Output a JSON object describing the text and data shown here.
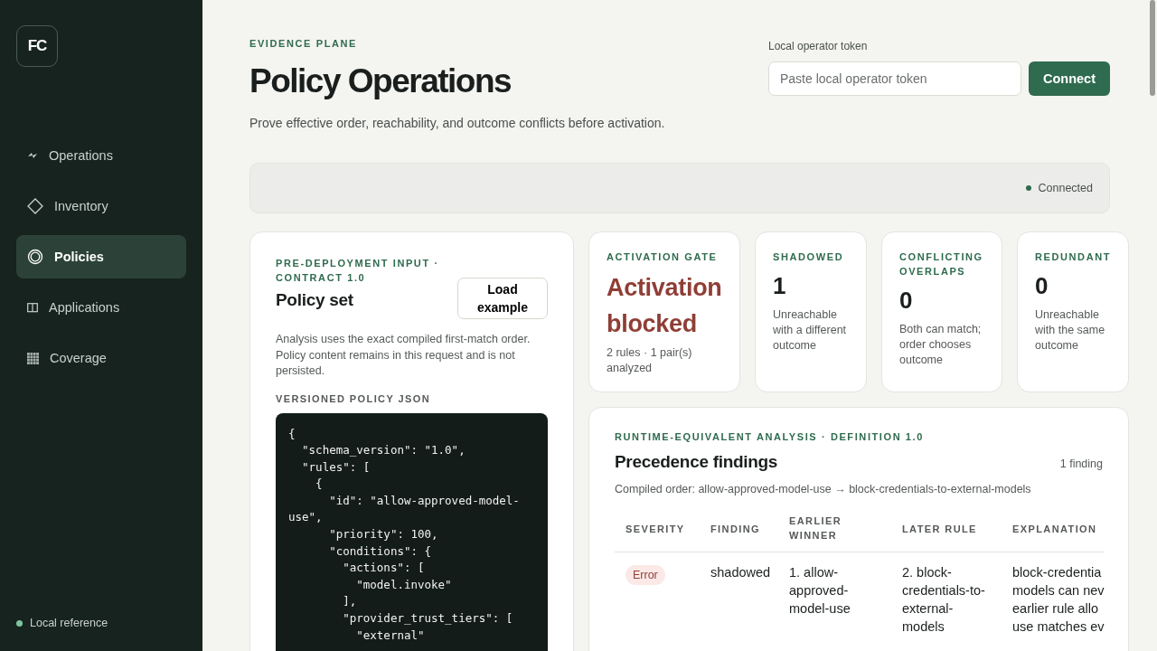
{
  "sidebar": {
    "logo": "FC",
    "items": [
      {
        "label": "Operations",
        "selected": false
      },
      {
        "label": "Inventory",
        "selected": false
      },
      {
        "label": "Policies",
        "selected": true
      },
      {
        "label": "Applications",
        "selected": false
      },
      {
        "label": "Coverage",
        "selected": false
      }
    ],
    "footer": {
      "label": "Local reference",
      "color": "#7fc4a0"
    }
  },
  "header": {
    "eyebrow": "EVIDENCE PLANE",
    "title": "Policy Operations",
    "subtitle": "Prove effective order, reachability, and outcome conflicts before activation.",
    "token": {
      "label": "Local operator token",
      "placeholder": "Paste local operator token",
      "button": "Connect"
    }
  },
  "status": {
    "label": "Connected",
    "color": "#2f6b4f"
  },
  "policy_card": {
    "eyebrow": "PRE-DEPLOYMENT INPUT · CONTRACT 1.0",
    "title": "Policy set",
    "button": "Load example",
    "note": "Analysis uses the exact compiled first-match order. Policy content remains in this request and is not persisted.",
    "code_label": "VERSIONED POLICY JSON",
    "code_lines": [
      "{",
      "  \"schema_version\": \"1.0\",",
      "  \"rules\": [",
      "    {",
      "      \"id\": \"allow-approved-model-",
      "use\",",
      "      \"priority\": 100,",
      "      \"conditions\": {",
      "        \"actions\": [",
      "          \"model.invoke\"",
      "        ],",
      "        \"provider_trust_tiers\": [",
      "          \"external\""
    ]
  },
  "stats": [
    {
      "kind": "gate",
      "label": "ACTIVATION GATE",
      "value": "Activation blocked",
      "note": "2 rules · 1 pair(s) analyzed"
    },
    {
      "kind": "count",
      "label": "SHADOWED",
      "value": "1",
      "note": "Unreachable with a different outcome"
    },
    {
      "kind": "count",
      "label": "CONFLICTING OVERLAPS",
      "value": "0",
      "note": "Both can match; order chooses outcome"
    },
    {
      "kind": "count",
      "label": "REDUNDANT",
      "value": "0",
      "note": "Unreachable with the same outcome"
    }
  ],
  "findings": {
    "eyebrow": "RUNTIME-EQUIVALENT ANALYSIS · DEFINITION 1.0",
    "title": "Precedence findings",
    "count": "1 finding",
    "order": "Compiled order: allow-approved-model-use → block-credentials-to-external-models",
    "columns": [
      "SEVERITY",
      "FINDING",
      "EARLIER WINNER",
      "LATER RULE",
      "EXPLANATION"
    ],
    "rows": [
      {
        "severity": {
          "kind": "error",
          "label": "Error"
        },
        "finding": "shadowed",
        "earlier": "1. allow-approved-model-use",
        "later": "2. block-credentials-to-external-models",
        "explanation": [
          "block-credentia",
          "models can nev",
          "earlier rule allo",
          "use matches ev"
        ]
      }
    ]
  }
}
